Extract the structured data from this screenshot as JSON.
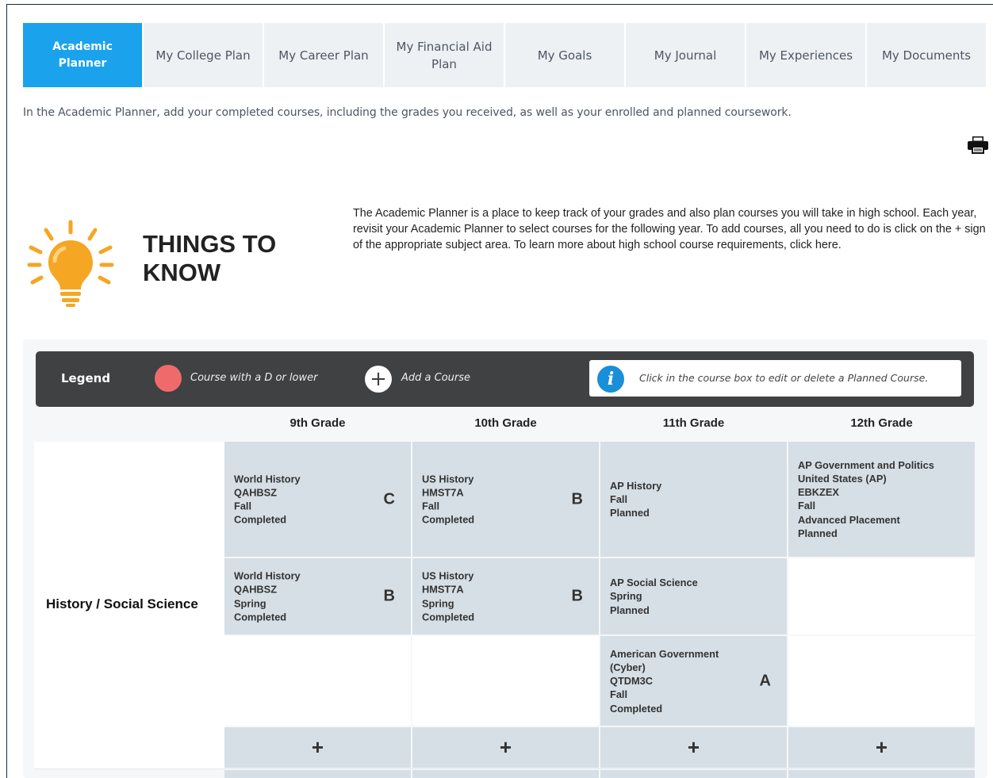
{
  "tabs": [
    {
      "label": "Academic Planner",
      "active": true
    },
    {
      "label": "My College Plan"
    },
    {
      "label": "My Career Plan"
    },
    {
      "label": "My Financial Aid Plan"
    },
    {
      "label": "My Goals"
    },
    {
      "label": "My Journal"
    },
    {
      "label": "My Experiences"
    },
    {
      "label": "My Documents"
    }
  ],
  "intro_text": "In the Academic Planner, add your completed courses, including the grades you received, as well as your enrolled and planned coursework.",
  "print_icon": "printer-icon",
  "things_to_know": {
    "title_line1": "THINGS TO",
    "title_line2": "KNOW",
    "icon": "lightbulb-icon",
    "description": "The Academic Planner is a place to keep track of your grades and also plan courses you will take in high school. Each year, revisit your Academic Planner to select courses for the following year. To add courses, all you need to do is click on the + sign of the appropriate subject area. To learn more about high school course requirements, click ",
    "link_text": "here."
  },
  "legend": {
    "title": "Legend",
    "low_grade_text": "Course with a D or lower",
    "add_text": "Add a Course",
    "add_symbol": "+",
    "info_symbol": "i",
    "info_text": "Click in the course box to edit or delete a Planned Course.",
    "low_grade_color": "#ef6b6b",
    "panel_color": "#3f4142",
    "info_color": "#1a8fd9"
  },
  "grades": [
    "9th Grade",
    "10th Grade",
    "11th Grade",
    "12th Grade"
  ],
  "subject": "History / Social Science",
  "add_symbol": "+",
  "rows": [
    [
      {
        "lines": [
          "World History",
          "QAHBSZ",
          "Fall",
          "Completed"
        ],
        "grade": "C"
      },
      {
        "lines": [
          "US History",
          "HMST7A",
          "Fall",
          "Completed"
        ],
        "grade": "B"
      },
      {
        "lines": [
          "AP History",
          "Fall",
          "Planned"
        ],
        "grade": ""
      },
      {
        "lines": [
          "AP Government and Politics United States (AP)",
          "EBKZEX",
          "Fall",
          "Advanced Placement",
          "Planned"
        ],
        "grade": ""
      }
    ],
    [
      {
        "lines": [
          "World History",
          "QAHBSZ",
          "Spring",
          "Completed"
        ],
        "grade": "B"
      },
      {
        "lines": [
          "US History",
          "HMST7A",
          "Spring",
          "Completed"
        ],
        "grade": "B"
      },
      {
        "lines": [
          "AP Social Science",
          "Spring",
          "Planned"
        ],
        "grade": ""
      },
      null
    ],
    [
      null,
      null,
      {
        "lines": [
          "American Government (Cyber)",
          "QTDM3C",
          "Fall",
          "Completed"
        ],
        "grade": "A"
      },
      null
    ]
  ],
  "accent_color": "#1aa3ec",
  "cell_color": "#d6dfe6"
}
